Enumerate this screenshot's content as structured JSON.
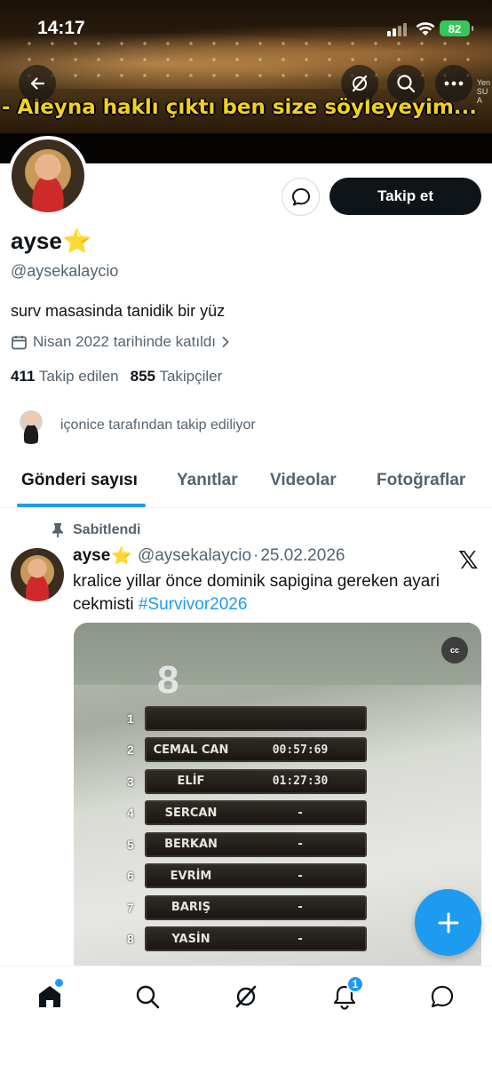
{
  "status_bar": {
    "time": "14:17",
    "battery": "82"
  },
  "banner": {
    "caption": "- Aleyna haklı çıktı ben size söyleyeyim...",
    "side_text": "Yen\nSU\nA"
  },
  "header_actions": {
    "back": "back-arrow-icon",
    "grok": "grok-icon",
    "search": "search-icon",
    "more": "more-icon"
  },
  "profile": {
    "name": "ayse",
    "name_emoji": "⭐",
    "handle": "@aysekalaycio",
    "bio": "surv masasinda tanidik bir yüz",
    "joined": "Nisan 2022 tarihinde katıldı",
    "following_count": "411",
    "following_label": "Takip edilen",
    "followers_count": "855",
    "followers_label": "Takipçiler",
    "followed_by": "içonice tarafından takip ediliyor",
    "follow_button": "Takip et"
  },
  "tabs": [
    "Gönderi sayısı",
    "Yanıtlar",
    "Videolar",
    "Fotoğraflar"
  ],
  "tweet": {
    "pinned_label": "Sabitlendi",
    "name": "ayse",
    "name_emoji": "⭐",
    "handle": "@aysekalaycio",
    "separator": "·",
    "date": "25.02.2026",
    "text": "kralice yillar önce dominik sapigina gereken ayari cekmisti ",
    "hashtag": "#Survivor2026",
    "media": {
      "cc": "cc",
      "big_number": "8",
      "board": [
        {
          "rank": "1",
          "name": "",
          "time": ""
        },
        {
          "rank": "2",
          "name": "CEMAL CAN",
          "time": "00:57:69"
        },
        {
          "rank": "3",
          "name": "ELİF",
          "time": "01:27:30"
        },
        {
          "rank": "4",
          "name": "SERCAN",
          "time": "-"
        },
        {
          "rank": "5",
          "name": "BERKAN",
          "time": "-"
        },
        {
          "rank": "6",
          "name": "EVRİM",
          "time": "-"
        },
        {
          "rank": "7",
          "name": "BARIŞ",
          "time": "-"
        },
        {
          "rank": "8",
          "name": "YASİN",
          "time": "-"
        }
      ]
    }
  },
  "bottom_nav": {
    "notifications_badge": "1"
  },
  "colors": {
    "accent": "#1d9bf0",
    "text": "#0f1419",
    "muted": "#536471"
  }
}
